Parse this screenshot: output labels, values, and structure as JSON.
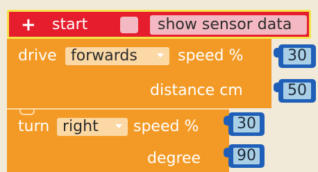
{
  "start_block": {
    "plus_symbol": "+",
    "label": "start",
    "sensor_label": "show sensor data"
  },
  "drive_block": {
    "label": "drive",
    "direction": "forwards",
    "speed_label": "speed %",
    "speed_value": "30",
    "distance_label": "distance cm",
    "distance_value": "50"
  },
  "turn_block": {
    "label": "turn",
    "direction": "right",
    "speed_label": "speed %",
    "speed_value": "30",
    "degree_label": "degree",
    "degree_value": "90"
  },
  "colors": {
    "background": "#f2ead9",
    "start_red": "#e51d2d",
    "start_outline": "#f6e34a",
    "motion_orange": "#f39a26",
    "number_blue": "#1f5fb8",
    "number_field": "#a9cfe6"
  }
}
